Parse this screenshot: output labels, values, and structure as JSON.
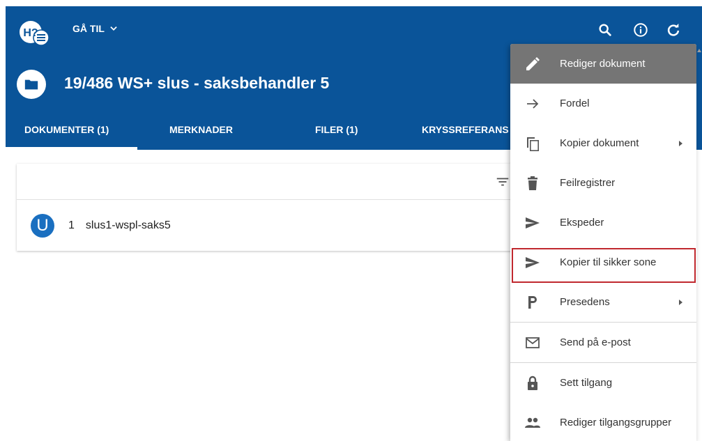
{
  "header": {
    "logo_text": "H?",
    "goto_label": "GÅ TIL",
    "case_title": "19/486 WS+ slus - saksbehandler 5"
  },
  "tabs": [
    {
      "label": "DOKUMENTER (1)",
      "active": true
    },
    {
      "label": "MERKNADER",
      "active": false
    },
    {
      "label": "FILER (1)",
      "active": false
    },
    {
      "label": "KRYSSREFERANS",
      "active": false
    }
  ],
  "documents": [
    {
      "avatar_letter": "U",
      "number": "1",
      "title": "slus1-wspl-saks5"
    }
  ],
  "context_menu": {
    "items": [
      {
        "label": "Rediger dokument",
        "icon": "pencil-icon",
        "active": true,
        "submenu": false
      },
      {
        "label": "Fordel",
        "icon": "arrow-right-icon",
        "active": false,
        "submenu": false
      },
      {
        "label": "Kopier dokument",
        "icon": "copy-icon",
        "active": false,
        "submenu": true
      },
      {
        "label": "Feilregistrer",
        "icon": "trash-icon",
        "active": false,
        "submenu": false
      },
      {
        "label": "Ekspeder",
        "icon": "send-icon",
        "active": false,
        "submenu": false
      },
      {
        "label": "Kopier til sikker sone",
        "icon": "send-icon",
        "active": false,
        "submenu": false,
        "highlighted": true
      },
      {
        "label": "Presedens",
        "icon": "letter-p-icon",
        "active": false,
        "submenu": true
      },
      {
        "label": "Send på e-post",
        "icon": "mail-icon",
        "active": false,
        "submenu": false
      },
      {
        "label": "Sett tilgang",
        "icon": "lock-icon",
        "active": false,
        "submenu": false
      },
      {
        "label": "Rediger tilgangsgrupper",
        "icon": "people-icon",
        "active": false,
        "submenu": false
      }
    ]
  },
  "colors": {
    "appbar": "#0a5499",
    "active_menu": "#757575",
    "highlight_border": "#c0282e",
    "avatar": "#1a6fc0"
  }
}
